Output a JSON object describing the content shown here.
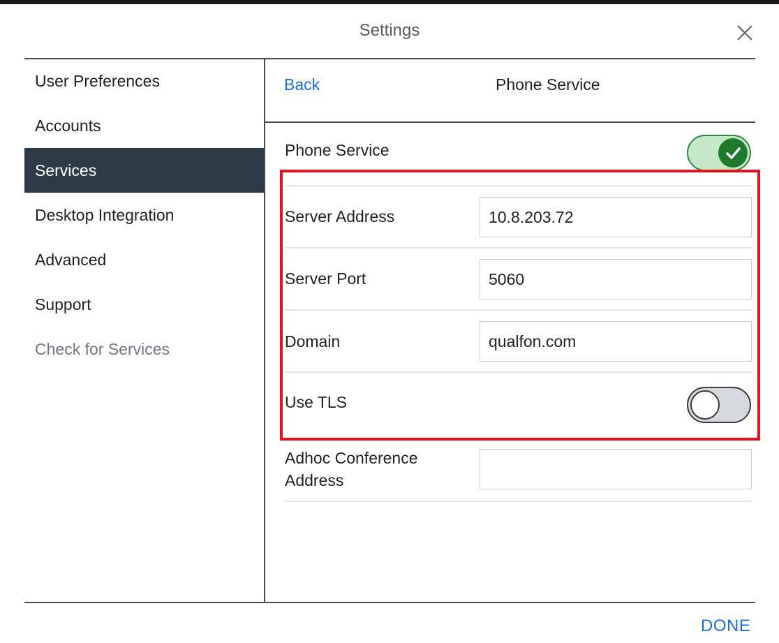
{
  "window": {
    "title": "Settings"
  },
  "sidebar": {
    "items": [
      {
        "label": "User Preferences",
        "active": false
      },
      {
        "label": "Accounts",
        "active": false
      },
      {
        "label": "Services",
        "active": true
      },
      {
        "label": "Desktop Integration",
        "active": false
      },
      {
        "label": "Advanced",
        "active": false
      },
      {
        "label": "Support",
        "active": false
      },
      {
        "label": "Check for Services",
        "active": false
      }
    ]
  },
  "header": {
    "back_label": "Back",
    "title": "Phone Service"
  },
  "form": {
    "phone_service": {
      "label": "Phone Service",
      "enabled": true
    },
    "server_address": {
      "label": "Server Address",
      "value": "10.8.203.72"
    },
    "server_port": {
      "label": "Server Port",
      "value": "5060"
    },
    "domain": {
      "label": "Domain",
      "value": "qualfon.com"
    },
    "use_tls": {
      "label": "Use TLS",
      "enabled": false
    },
    "adhoc_conference": {
      "label": "Adhoc Conference Address",
      "value": ""
    }
  },
  "footer": {
    "done_label": "DONE"
  },
  "colors": {
    "accent": "#1a6ed8",
    "sidebar_active": "#2d3a48",
    "toggle_on": "#1f7a2e",
    "highlight": "#e8131e"
  }
}
